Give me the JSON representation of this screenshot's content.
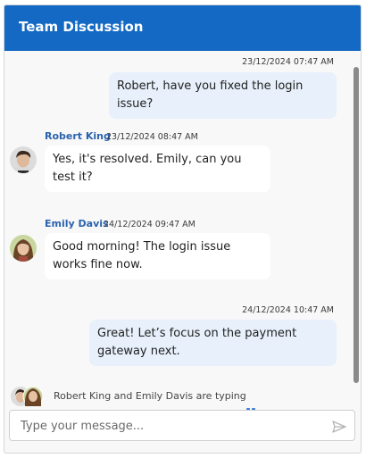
{
  "header": {
    "title": "Team Discussion"
  },
  "messages": [
    {
      "direction": "out",
      "timestamp": "23/12/2024 07:47 AM",
      "text": "Robert, have you fixed the login issue?"
    },
    {
      "direction": "in",
      "author": "Robert King",
      "timestamp": "23/12/2024 08:47 AM",
      "text": "Yes, it's resolved. Emily, can you test it?",
      "avatar_icon": "avatar-robert"
    },
    {
      "direction": "in",
      "author": "Emily Davis",
      "timestamp": "24/12/2024 09:47 AM",
      "text": "Good morning! The login issue works fine now.",
      "avatar_icon": "avatar-emily"
    },
    {
      "direction": "out",
      "timestamp": "24/12/2024 10:47 AM",
      "text": "Great! Let’s focus on the payment gateway next."
    }
  ],
  "typing": {
    "text": "Robert King and Emily Davis are typing"
  },
  "composer": {
    "placeholder": "Type your message...",
    "send_icon": "send-icon"
  },
  "colors": {
    "header": "#1469c4",
    "author_name": "#2a63ad",
    "outgoing_bubble": "#e7f0fb",
    "incoming_bubble": "#ffffff",
    "typing_dots": "#3b7dd8"
  }
}
